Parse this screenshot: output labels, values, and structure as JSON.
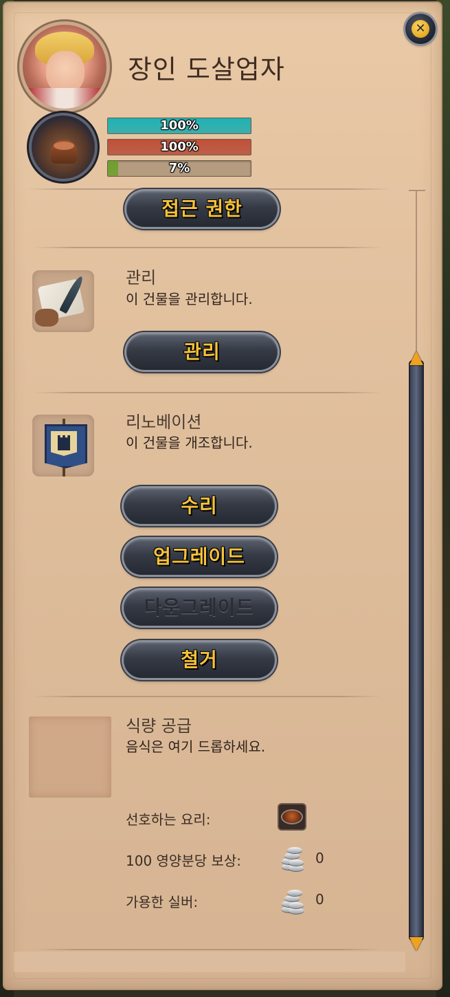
{
  "header": {
    "title": "장인 도살업자",
    "close_icon": "close-icon"
  },
  "status_bars": [
    {
      "text": "100%",
      "fraction": 1.0,
      "color": "#1fb3b6"
    },
    {
      "text": "100%",
      "fraction": 1.0,
      "color": "#c0503a"
    },
    {
      "text": "7%",
      "fraction": 0.07,
      "color": "#6ba02a"
    }
  ],
  "access": {
    "button_label": "접근 권한"
  },
  "manage": {
    "title": "관리",
    "description": "이 건물을 관리합니다.",
    "button_label": "관리",
    "icon": "scroll-quill-icon"
  },
  "renovation": {
    "title": "리노베이션",
    "description": "이 건물을 개조합니다.",
    "icon": "castle-banner-icon",
    "buttons": {
      "repair": "수리",
      "upgrade": "업그레이드",
      "downgrade": "다운그레이드",
      "demolish": "철거"
    }
  },
  "food_supply": {
    "title": "식량 공급",
    "description": "음식은 여기 드롭하세요.",
    "preferred_dish_label": "선호하는 요리:",
    "reward_label": "100 영양분당 보상:",
    "reward_value": "0",
    "silver_label": "가용한 실버:",
    "silver_value": "0",
    "dish_icon": "dish-icon",
    "coin_icon": "silver-coins-icon"
  }
}
